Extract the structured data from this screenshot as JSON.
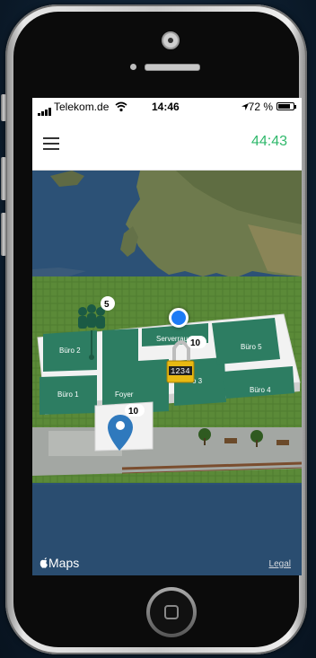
{
  "status_bar": {
    "carrier": "Telekom.de",
    "time": "14:46",
    "battery": "72 %"
  },
  "app_bar": {
    "menu_icon": "hamburger-icon",
    "timer": "44:43"
  },
  "map": {
    "attribution": "Maps",
    "legal": "Legal",
    "rooms": {
      "buero2": "Büro 2",
      "buero1": "Büro 1",
      "foyer": "Foyer",
      "serverraum": "Serverrau",
      "buero3": "o 3",
      "buero5": "Büro 5",
      "buero4": "Büro 4"
    },
    "markers": {
      "group_count": "5",
      "lock_count": "10",
      "lock_code": "1234",
      "pin_count": "10"
    }
  },
  "colors": {
    "accent": "#2fb86b",
    "room": "#2d7d62",
    "grass": "#5d8b3a",
    "location": "#1d7bf5",
    "lock": "#e9b912"
  }
}
